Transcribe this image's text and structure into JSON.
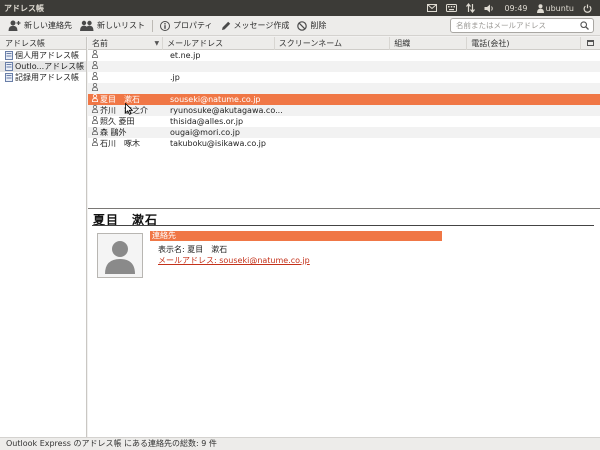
{
  "window": {
    "title": "アドレス帳"
  },
  "panel": {
    "time": "09:49",
    "user": "ubuntu"
  },
  "toolbar": {
    "new_contact": "新しい連絡先",
    "new_list": "新しいリスト",
    "properties": "プロパティ",
    "compose": "メッセージ作成",
    "delete": "削除",
    "search_placeholder": "名前またはメールアドレス"
  },
  "sidebar": {
    "header": "アドレス帳",
    "items": [
      {
        "label": "個人用アドレス帳"
      },
      {
        "label": "Outlo...アドレス帳"
      },
      {
        "label": "記録用アドレス帳"
      }
    ]
  },
  "columns": {
    "name": "名前",
    "mail": "メールアドレス",
    "screen": "スクリーンネーム",
    "org": "組織",
    "tel": "電話(会社)"
  },
  "rows": [
    {
      "name": "",
      "mail": "et.ne.jp"
    },
    {
      "name": "",
      "mail": ""
    },
    {
      "name": "",
      "mail": ".jp"
    },
    {
      "name": "",
      "mail": ""
    },
    {
      "name": "夏目　漱石",
      "mail": "souseki@natume.co.jp"
    },
    {
      "name": "芥川　龍之介",
      "mail": "ryunosuke@akutagawa.co..."
    },
    {
      "name": "照久 菱田",
      "mail": "thisida@alles.or.jp"
    },
    {
      "name": "森 鷗外",
      "mail": "ougai@mori.co.jp"
    },
    {
      "name": "石川　啄木",
      "mail": "takuboku@isikawa.co.jp"
    }
  ],
  "detail": {
    "name": "夏目　漱石",
    "section": "連絡先",
    "display_name": "表示名: 夏目　漱石",
    "email": "メールアドレス: souseki@natume.co.jp"
  },
  "status": "Outlook Express のアドレス帳 にある連絡先の総数: 9 件",
  "colors": {
    "accent": "#f07746",
    "panel": "#3c3b37",
    "link": "#c4311a"
  }
}
